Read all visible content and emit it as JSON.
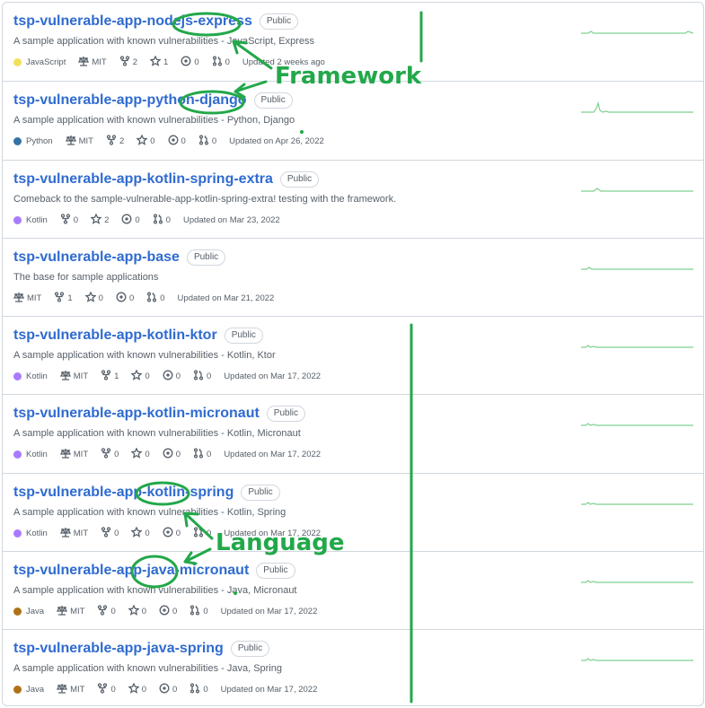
{
  "colors": {
    "link": "#2f6bd0",
    "annotation": "#22a84a",
    "javascript": "#f1e05a",
    "python": "#3572A5",
    "kotlin": "#A97BFF",
    "java": "#b07219"
  },
  "repos": [
    {
      "name": "tsp-vulnerable-app-nodejs-express",
      "visibility": "Public",
      "description": "A sample application with known vulnerabilities - JavaScript, Express",
      "language": "JavaScript",
      "language_color": "#f1e05a",
      "license": "MIT",
      "forks": "2",
      "stars": "1",
      "issues": "0",
      "pulls": "0",
      "updated": "Updated 2 weeks ago"
    },
    {
      "name": "tsp-vulnerable-app-python-django",
      "visibility": "Public",
      "description": "A sample application with known vulnerabilities - Python, Django",
      "language": "Python",
      "language_color": "#3572A5",
      "license": "MIT",
      "forks": "2",
      "stars": "0",
      "issues": "0",
      "pulls": "0",
      "updated": "Updated on Apr 26, 2022"
    },
    {
      "name": "tsp-vulnerable-app-kotlin-spring-extra",
      "visibility": "Public",
      "description": "Comeback to the sample-vulnerable-app-kotlin-spring-extra! testing with the framework.",
      "language": "Kotlin",
      "language_color": "#A97BFF",
      "license": null,
      "forks": "0",
      "stars": "2",
      "issues": "0",
      "pulls": "0",
      "updated": "Updated on Mar 23, 2022"
    },
    {
      "name": "tsp-vulnerable-app-base",
      "visibility": "Public",
      "description": "The base for sample applications",
      "language": null,
      "language_color": null,
      "license": "MIT",
      "forks": "1",
      "stars": "0",
      "issues": "0",
      "pulls": "0",
      "updated": "Updated on Mar 21, 2022"
    },
    {
      "name": "tsp-vulnerable-app-kotlin-ktor",
      "visibility": "Public",
      "description": "A sample application with known vulnerabilities - Kotlin, Ktor",
      "language": "Kotlin",
      "language_color": "#A97BFF",
      "license": "MIT",
      "forks": "1",
      "stars": "0",
      "issues": "0",
      "pulls": "0",
      "updated": "Updated on Mar 17, 2022"
    },
    {
      "name": "tsp-vulnerable-app-kotlin-micronaut",
      "visibility": "Public",
      "description": "A sample application with known vulnerabilities - Kotlin, Micronaut",
      "language": "Kotlin",
      "language_color": "#A97BFF",
      "license": "MIT",
      "forks": "0",
      "stars": "0",
      "issues": "0",
      "pulls": "0",
      "updated": "Updated on Mar 17, 2022"
    },
    {
      "name": "tsp-vulnerable-app-kotlin-spring",
      "visibility": "Public",
      "description": "A sample application with known vulnerabilities - Kotlin, Spring",
      "language": "Kotlin",
      "language_color": "#A97BFF",
      "license": "MIT",
      "forks": "0",
      "stars": "0",
      "issues": "0",
      "pulls": "0",
      "updated": "Updated on Mar 17, 2022"
    },
    {
      "name": "tsp-vulnerable-app-java-micronaut",
      "visibility": "Public",
      "description": "A sample application with known vulnerabilities - Java, Micronaut",
      "language": "Java",
      "language_color": "#b07219",
      "license": "MIT",
      "forks": "0",
      "stars": "0",
      "issues": "0",
      "pulls": "0",
      "updated": "Updated on Mar 17, 2022"
    },
    {
      "name": "tsp-vulnerable-app-java-spring",
      "visibility": "Public",
      "description": "A sample application with known vulnerabilities - Java, Spring",
      "language": "Java",
      "language_color": "#b07219",
      "license": "MIT",
      "forks": "0",
      "stars": "0",
      "issues": "0",
      "pulls": "0",
      "updated": "Updated on Mar 17, 2022"
    }
  ],
  "annotations": {
    "framework_label": "Framework",
    "language_label": "Language"
  }
}
